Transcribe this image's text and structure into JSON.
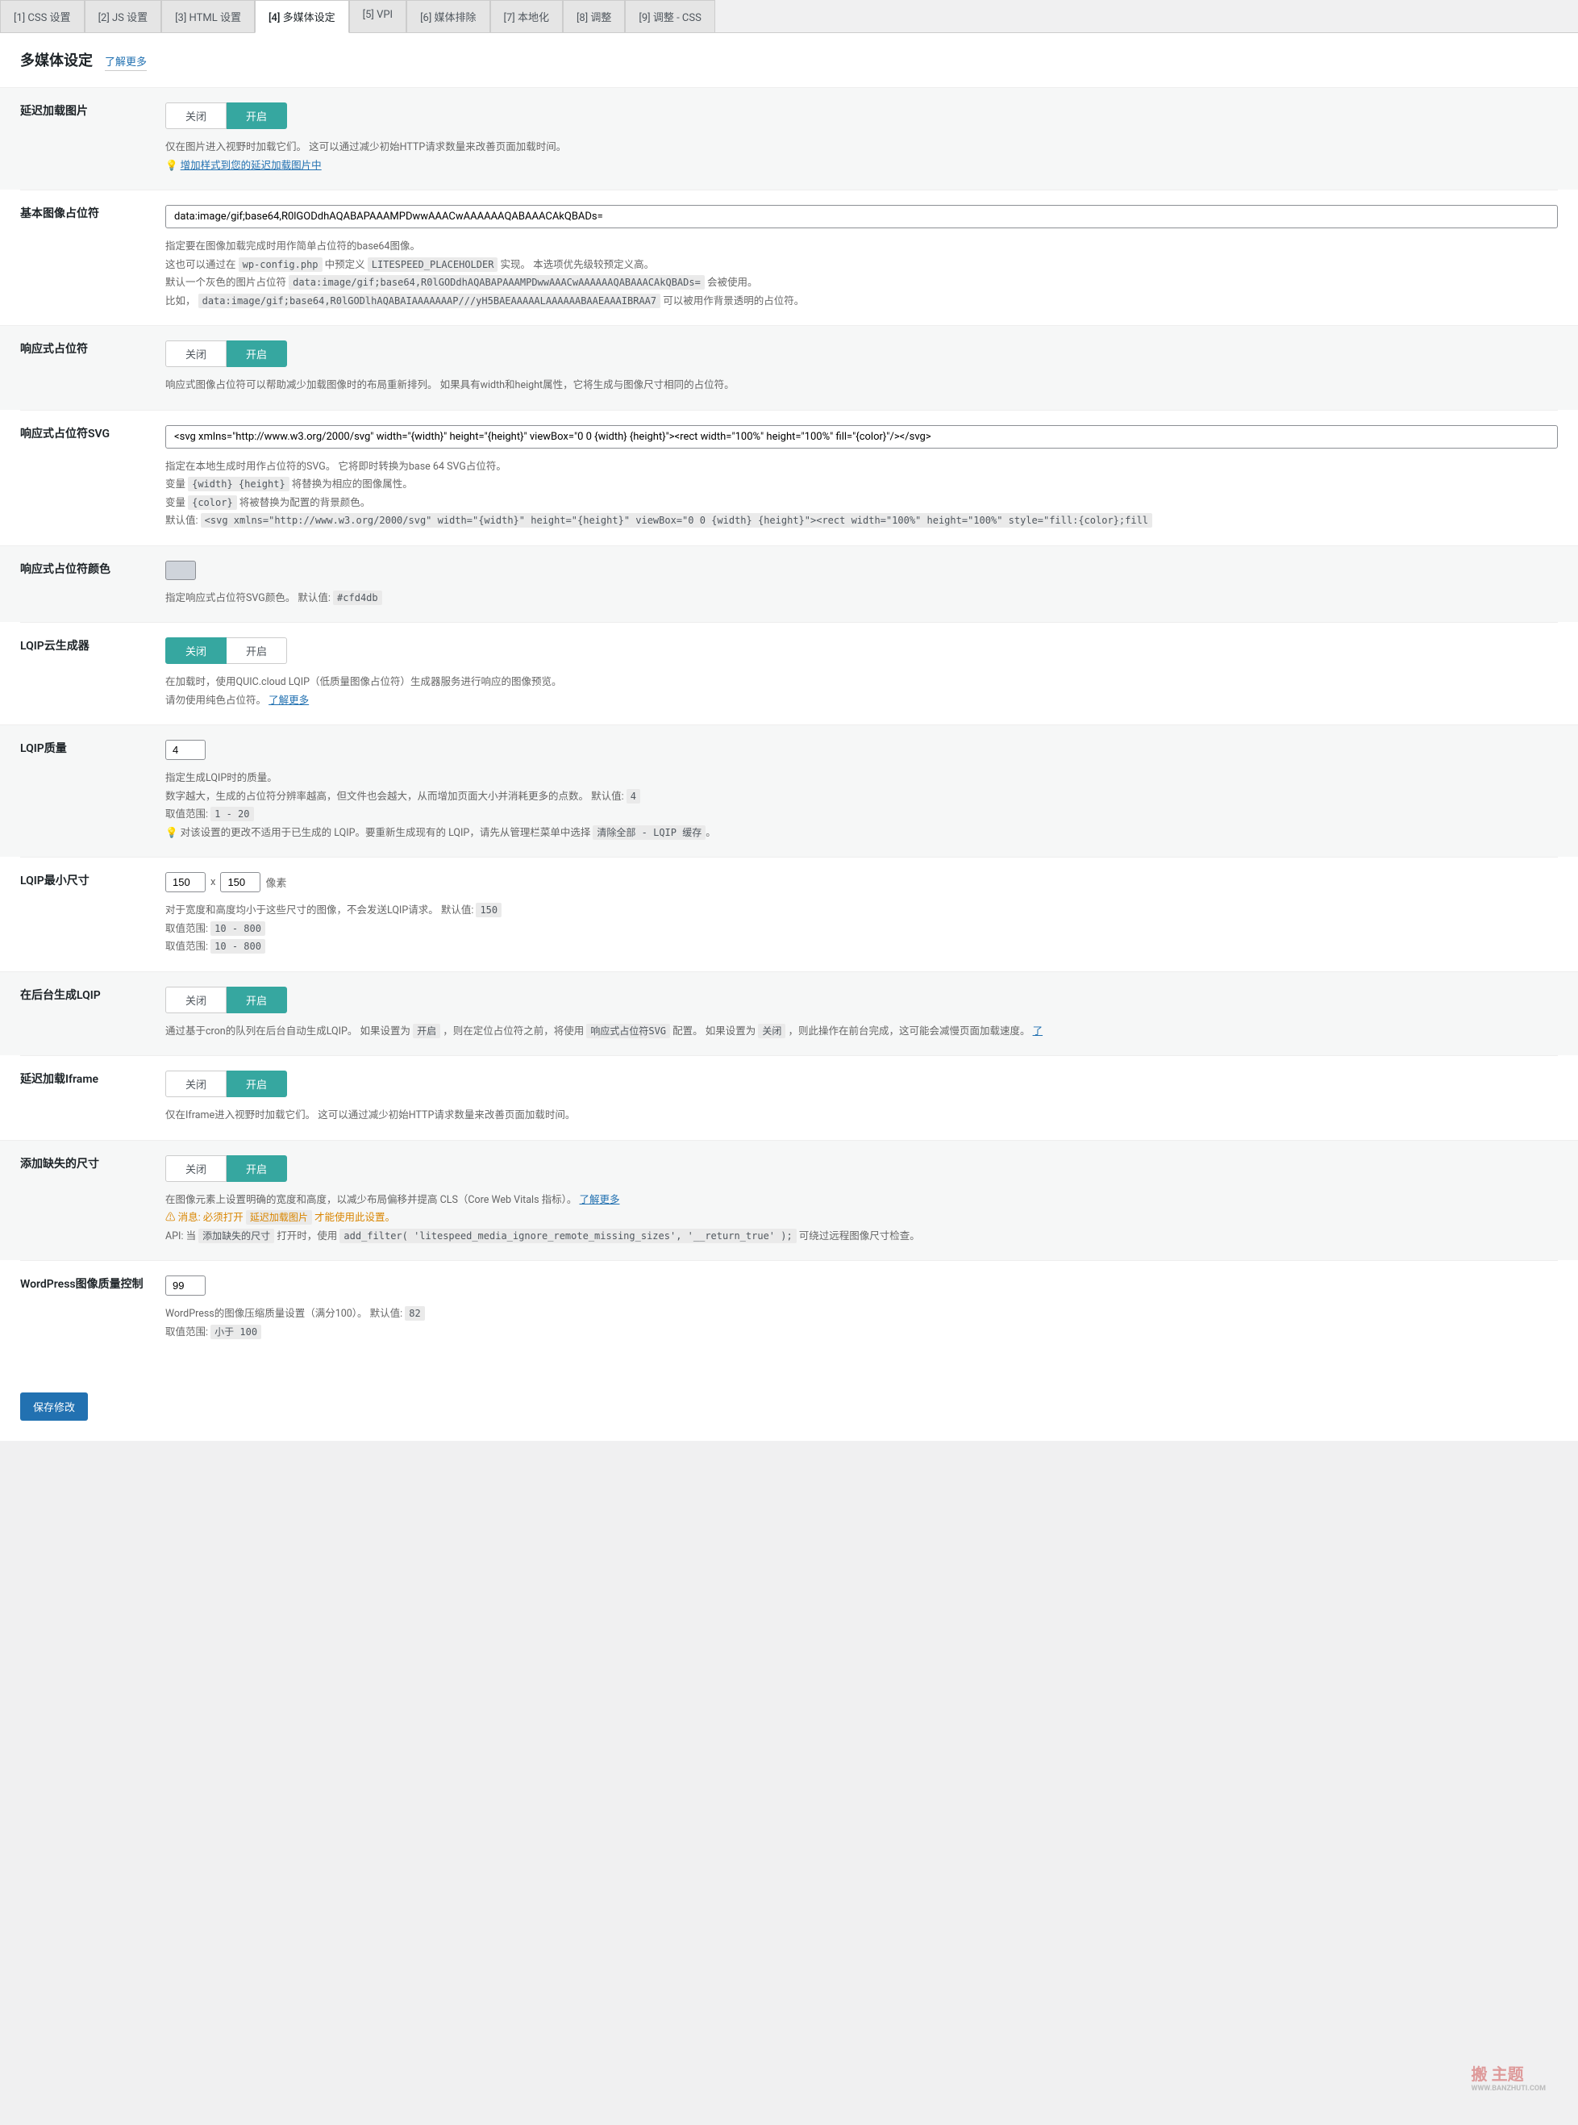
{
  "tabs": [
    {
      "label": "[1] CSS 设置"
    },
    {
      "label": "[2] JS 设置"
    },
    {
      "label": "[3] HTML 设置"
    },
    {
      "label": "[4] 多媒体设定"
    },
    {
      "label": "[5] VPI"
    },
    {
      "label": "[6] 媒体排除"
    },
    {
      "label": "[7] 本地化"
    },
    {
      "label": "[8] 调整"
    },
    {
      "label": "[9] 调整 - CSS"
    }
  ],
  "heading": {
    "title": "多媒体设定",
    "more": "了解更多"
  },
  "toggle_labels": {
    "off": "关闭",
    "on": "开启"
  },
  "sections": {
    "lazy_img": {
      "label": "延迟加载图片",
      "desc": "仅在图片进入视野时加载它们。 这可以通过减少初始HTTP请求数量来改善页面加载时间。",
      "tip": "增加样式到您的延迟加载图片中"
    },
    "placeholder": {
      "label": "基本图像占位符",
      "value": "data:image/gif;base64,R0lGODdhAQABAPAAAMPDwwAAACwAAAAAAQABAAACAkQBADs=",
      "d1": "指定要在图像加载完成时用作简单占位符的base64图像。",
      "d2a": "这也可以通过在 ",
      "d2code": "wp-config.php",
      "d2b": " 中预定义 ",
      "d2code2": "LITESPEED_PLACEHOLDER",
      "d2c": " 实现。 本选项优先级较预定义高。",
      "d3a": "默认一个灰色的图片占位符 ",
      "d3code": "data:image/gif;base64,R0lGODdhAQABAPAAAMPDwwAAACwAAAAAAQABAAACAkQBADs=",
      "d3b": " 会被使用。",
      "d4a": "比如， ",
      "d4code": "data:image/gif;base64,R0lGODlhAQABAIAAAAAAAP///yH5BAEAAAAALAAAAAABAAEAAAIBRAA7",
      "d4b": " 可以被用作背景透明的占位符。"
    },
    "responsive": {
      "label": "响应式占位符",
      "desc": "响应式图像占位符可以帮助减少加载图像时的布局重新排列。 如果具有width和height属性，它将生成与图像尺寸相同的占位符。"
    },
    "svg": {
      "label": "响应式占位符SVG",
      "value": "<svg xmlns=\"http://www.w3.org/2000/svg\" width=\"{width}\" height=\"{height}\" viewBox=\"0 0 {width} {height}\"><rect width=\"100%\" height=\"100%\" fill=\"{color}\"/></svg>",
      "d1": "指定在本地生成时用作占位符的SVG。 它将即时转换为base 64 SVG占位符。",
      "d2a": "变量 ",
      "d2code": "{width} {height}",
      "d2b": " 将替换为相应的图像属性。",
      "d3a": "变量 ",
      "d3code": "{color}",
      "d3b": " 将被替换为配置的背景颜色。",
      "d4a": "默认值: ",
      "d4code": "<svg xmlns=\"http://www.w3.org/2000/svg\" width=\"{width}\" height=\"{height}\" viewBox=\"0 0 {width} {height}\"><rect width=\"100%\" height=\"100%\" style=\"fill:{color};fill"
    },
    "svg_color": {
      "label": "响应式占位符颜色",
      "d1a": "指定响应式占位符SVG颜色。 默认值: ",
      "d1code": "#cfd4db"
    },
    "lqip_cloud": {
      "label": "LQIP云生成器",
      "d1": "在加载时，使用QUIC.cloud LQIP（低质量图像占位符）生成器服务进行响应的图像预览。",
      "d2a": "请勿使用纯色占位符。 ",
      "d2link": "了解更多"
    },
    "lqip_quality": {
      "label": "LQIP质量",
      "value": "4",
      "d1": "指定生成LQIP时的质量。",
      "d2a": "数字越大，生成的占位符分辨率越高，但文件也会越大，从而增加页面大小并消耗更多的点数。 默认值: ",
      "d2code": "4",
      "d3a": "取值范围: ",
      "d3code": "1 - 20",
      "d4a": "对该设置的更改不适用于已生成的 LQIP。要重新生成现有的 LQIP，请先从管理栏菜单中选择 ",
      "d4code": "清除全部 - LQIP 缓存",
      "d4b": "。"
    },
    "lqip_min": {
      "label": "LQIP最小尺寸",
      "w": "150",
      "h": "150",
      "unit": "像素",
      "x": "x",
      "d1a": "对于宽度和高度均小于这些尺寸的图像，不会发送LQIP请求。 默认值: ",
      "d1code": "150",
      "d2a": "取值范围: ",
      "d2code": "10 - 800",
      "d3a": "取值范围: ",
      "d3code": "10 - 800"
    },
    "lqip_bg": {
      "label": "在后台生成LQIP",
      "d1a": "通过基于cron的队列在后台自动生成LQIP。 如果设置为 ",
      "d1code": "开启",
      "d1b": " ，则在定位占位符之前，将使用 ",
      "d1code2": "响应式占位符SVG",
      "d1c": " 配置。 如果设置为 ",
      "d1code3": "关闭",
      "d1d": " ，则此操作在前台完成，这可能会减慢页面加载速度。 ",
      "d1link": "了"
    },
    "lazy_iframe": {
      "label": "延迟加载Iframe",
      "d1": "仅在Iframe进入视野时加载它们。 这可以通过减少初始HTTP请求数量来改善页面加载时间。"
    },
    "missing_size": {
      "label": "添加缺失的尺寸",
      "d1a": "在图像元素上设置明确的宽度和高度，以减少布局偏移并提高 CLS（Core Web Vitals 指标）。 ",
      "d1link": "了解更多",
      "warn_a": "消息: 必须打开 ",
      "warn_code": "延迟加载图片",
      "warn_b": " 才能使用此设置。",
      "d3a": "API: 当 ",
      "d3code": "添加缺失的尺寸",
      "d3b": " 打开时，使用 ",
      "d3code2": "add_filter( 'litespeed_media_ignore_remote_missing_sizes', '__return_true' );",
      "d3c": " 可绕过远程图像尺寸检查。"
    },
    "wp_quality": {
      "label": "WordPress图像质量控制",
      "value": "99",
      "d1a": "WordPress的图像压缩质量设置（满分100）。 默认值: ",
      "d1code": "82",
      "d2a": "取值范围: ",
      "d2code": "小于 100"
    }
  },
  "submit": "保存修改",
  "watermark": {
    "main": "搬 主题",
    "sub": "WWW.BANZHUTI.COM"
  }
}
